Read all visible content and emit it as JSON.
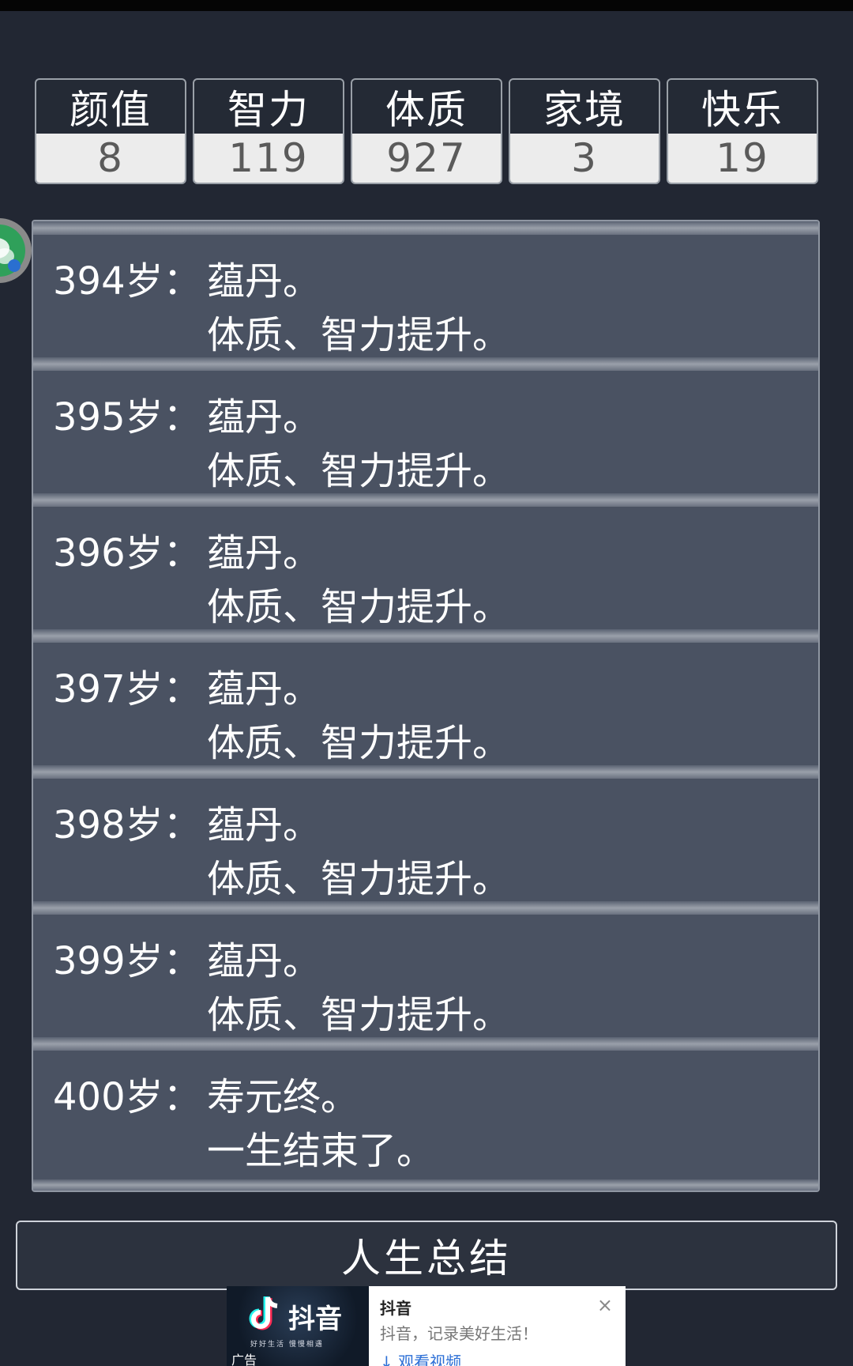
{
  "stats": [
    {
      "label": "颜值",
      "value": "8"
    },
    {
      "label": "智力",
      "value": "119"
    },
    {
      "label": "体质",
      "value": "927"
    },
    {
      "label": "家境",
      "value": "3"
    },
    {
      "label": "快乐",
      "value": "19"
    }
  ],
  "log": [
    {
      "age": "394岁：",
      "line1": "蕴丹。",
      "line2": "体质、智力提升。"
    },
    {
      "age": "395岁：",
      "line1": "蕴丹。",
      "line2": "体质、智力提升。"
    },
    {
      "age": "396岁：",
      "line1": "蕴丹。",
      "line2": "体质、智力提升。"
    },
    {
      "age": "397岁：",
      "line1": "蕴丹。",
      "line2": "体质、智力提升。"
    },
    {
      "age": "398岁：",
      "line1": "蕴丹。",
      "line2": "体质、智力提升。"
    },
    {
      "age": "399岁：",
      "line1": "蕴丹。",
      "line2": "体质、智力提升。"
    },
    {
      "age": "400岁：",
      "line1": "寿元终。",
      "line2": "一生结束了。"
    }
  ],
  "summary_button": "人生总结",
  "ad": {
    "brand": "抖音",
    "slogan": "好好生活 慢慢相遇",
    "tag": "广告",
    "title": "抖音",
    "description": "抖音，记录美好生活！",
    "cta": "↓ 观看视频",
    "close": "×"
  },
  "icons": {
    "floating_bubble": "wechat-bubble-icon",
    "ad_logo": "douyin-logo-icon",
    "ad_close": "close-icon"
  }
}
